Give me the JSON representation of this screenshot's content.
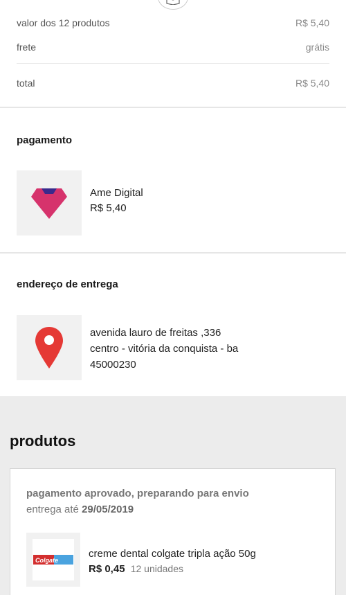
{
  "summary": {
    "subtotal_label": "valor dos 12 produtos",
    "subtotal_value": "R$ 5,40",
    "shipping_label": "frete",
    "shipping_value": "grátis",
    "total_label": "total",
    "total_value": "R$ 5,40"
  },
  "payment": {
    "title": "pagamento",
    "method_name": "Ame Digital",
    "amount": "R$ 5,40",
    "icon": "ame-logo-icon",
    "brand_color": "#d6336c"
  },
  "address": {
    "title": "endereço de entrega",
    "line1": "avenida lauro de freitas ,336",
    "line2": "centro - vitória da conquista - ba",
    "line3": "45000230",
    "icon": "map-pin-icon",
    "pin_color": "#e53935"
  },
  "products": {
    "title": "produtos",
    "status": "pagamento aprovado, preparando para envio",
    "delivery_prefix": "entrega até",
    "delivery_date": "29/05/2019",
    "items": [
      {
        "name": "creme dental colgate tripla ação 50g",
        "price": "R$ 0,45",
        "units": "12 unidades",
        "image_icon": "toothpaste-icon",
        "brand_text": "Colgate"
      }
    ]
  }
}
